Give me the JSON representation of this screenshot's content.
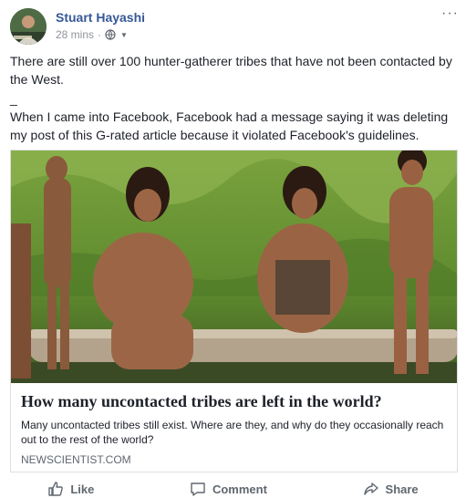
{
  "post": {
    "author": "Stuart Hayashi",
    "timestamp": "28 mins",
    "separator": "·",
    "privacy_icon": "globe-icon",
    "more_label": "···",
    "text": {
      "line1": "There are still over 100 hunter-gatherer tribes that have not been contacted by the West.",
      "line2": "_",
      "line3": "When I came into Facebook, Facebook had a message saying it was deleting my post of this G-rated article because it violated Facebook's guidelines."
    }
  },
  "link_card": {
    "title": "How many uncontacted tribes are left in the world?",
    "description": "Many uncontacted tribes still exist. Where are they, and why do they occasionally reach out to the rest of the world?",
    "domain": "NEWSCIENTIST.COM"
  },
  "actions": {
    "like": "Like",
    "comment": "Comment",
    "share": "Share"
  },
  "colors": {
    "author_link": "#365899",
    "meta_gray": "#90949c",
    "text": "#1d2129",
    "border": "#dddfe2"
  }
}
